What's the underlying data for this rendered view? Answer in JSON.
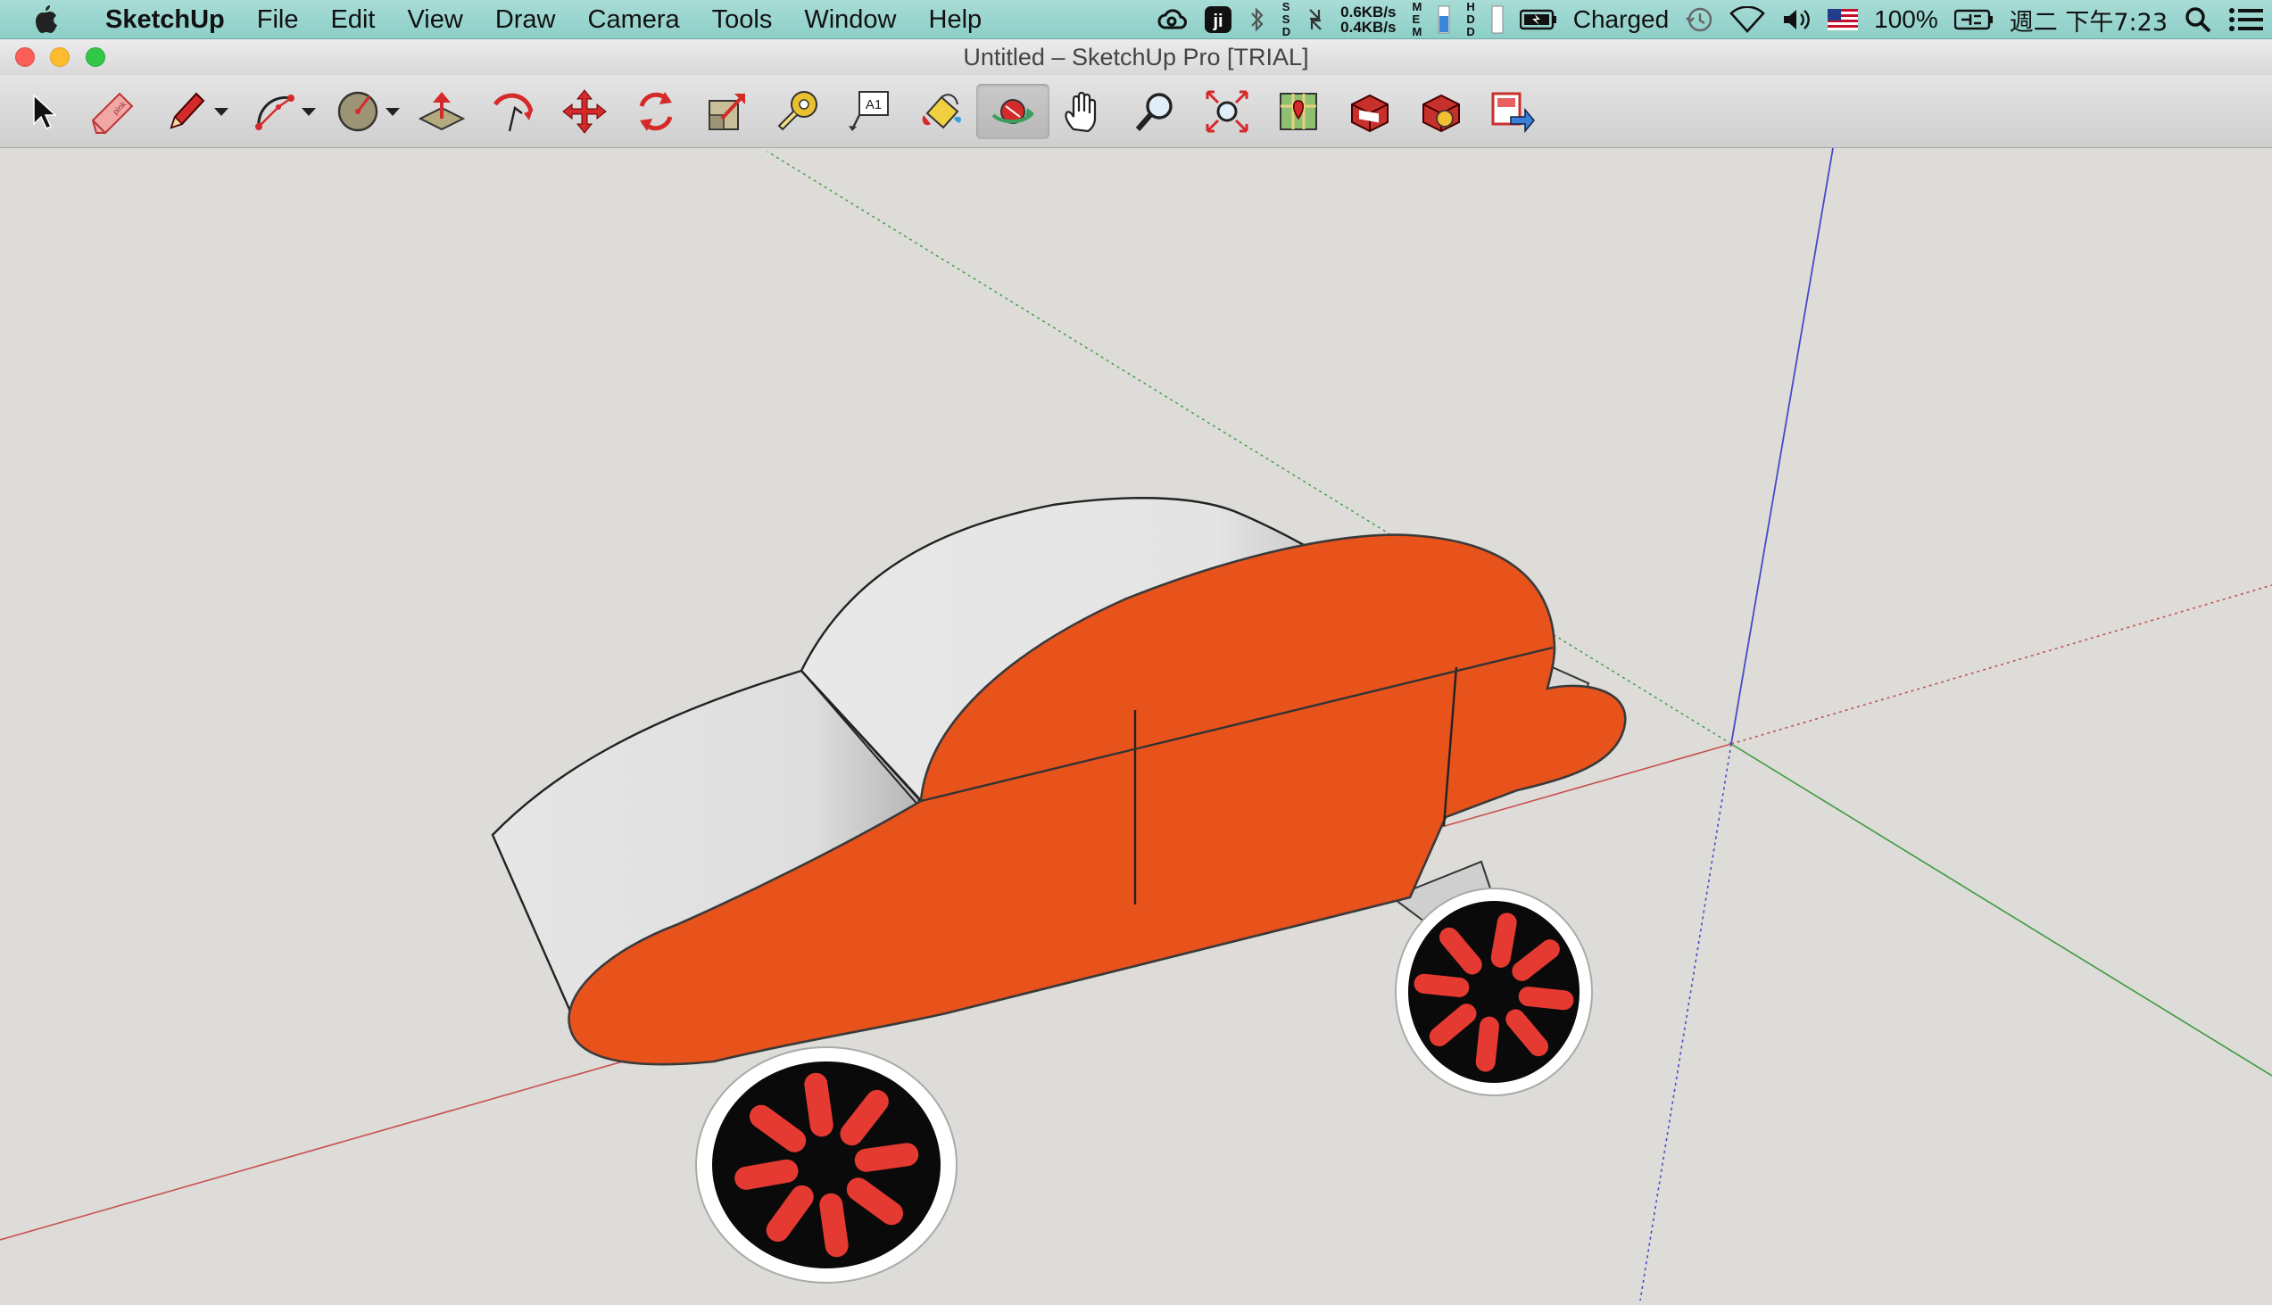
{
  "menubar": {
    "app_name": "SketchUp",
    "items": [
      "File",
      "Edit",
      "View",
      "Draw",
      "Camera",
      "Tools",
      "Window",
      "Help"
    ],
    "net_up": "0.6KB/s",
    "net_down": "0.4KB/s",
    "battery_text": "Charged",
    "battery_percent": "100%",
    "clock": "週二 下午7:23",
    "stack_labels": [
      "S\nS\nD",
      "M\nE\nM",
      "H\nD\nD"
    ]
  },
  "window": {
    "title": "Untitled – SketchUp Pro [TRIAL]"
  },
  "toolbar": {
    "text_tool_glyph": "A1",
    "active_tool": "orbit"
  },
  "colors": {
    "car_body": "#e8531c",
    "car_roof": "#e6e6e6",
    "wheel_tire": "#ffffff",
    "wheel_hub": "#0a0a0a",
    "wheel_spoke": "#e53a32",
    "axis_red": "#c85050",
    "axis_green": "#3d9a3d",
    "axis_blue": "#4848c8",
    "background": "#dddcd8"
  }
}
